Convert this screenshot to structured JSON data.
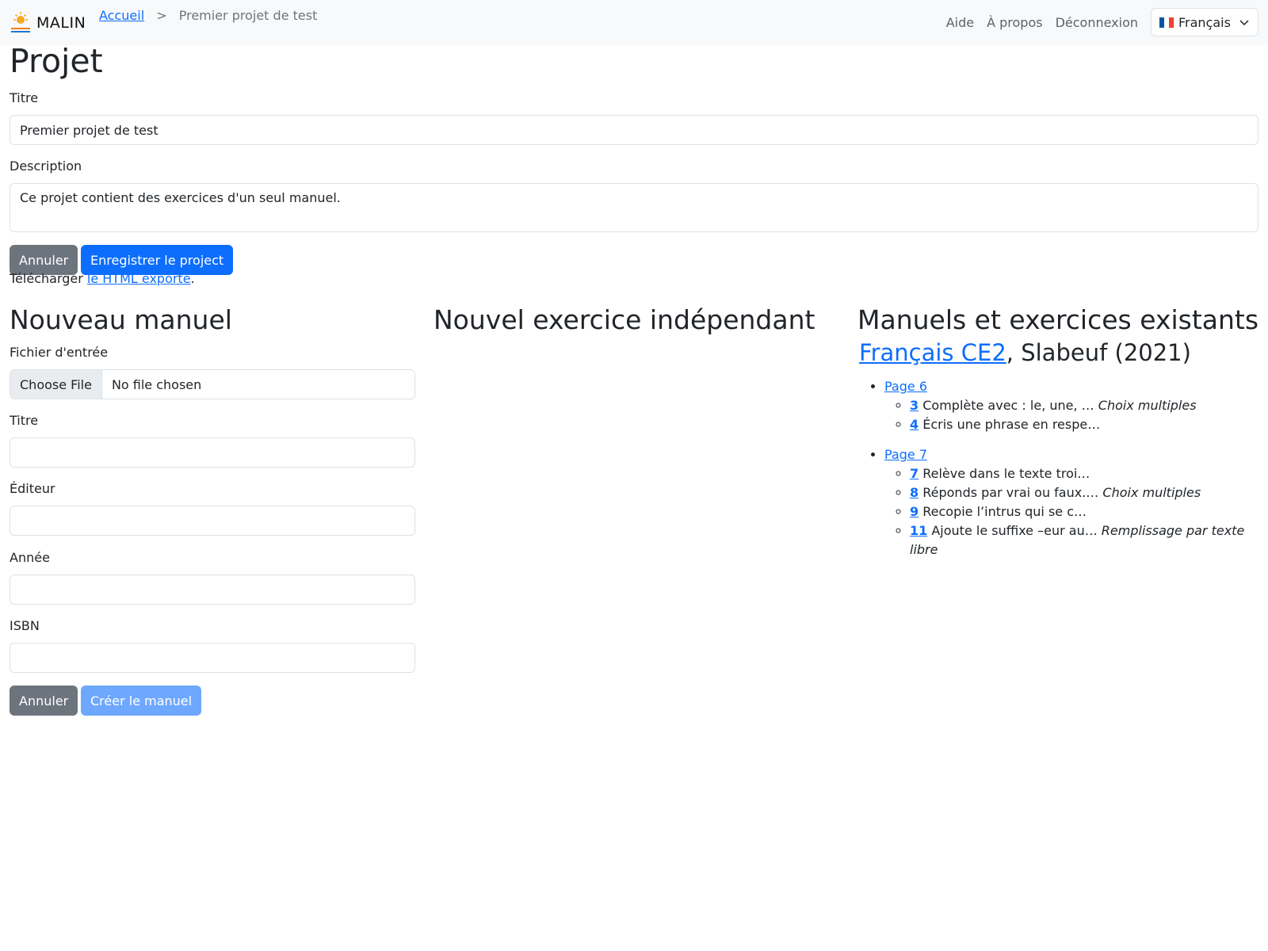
{
  "navbar": {
    "brand": "MALIN",
    "breadcrumb": {
      "home": "Accueil",
      "separator": ">",
      "current": "Premier projet de test"
    },
    "links": [
      "Aide",
      "À propos",
      "Déconnexion"
    ],
    "language": "Français"
  },
  "project": {
    "heading": "Projet",
    "title_label": "Titre",
    "title_value": "Premier projet de test",
    "description_label": "Description",
    "description_value": "Ce projet contient des exercices d'un seul manuel.",
    "cancel_label": "Annuler",
    "save_label": "Enregistrer le project",
    "download_prefix": "Télécharger ",
    "download_link": "le HTML exporté",
    "download_suffix": "."
  },
  "new_textbook": {
    "heading": "Nouveau manuel",
    "file_label": "Fichier d'entrée",
    "file_button": "Choose File",
    "file_status": "No file chosen",
    "title_label": "Titre",
    "editor_label": "Éditeur",
    "year_label": "Année",
    "isbn_label": "ISBN",
    "cancel_label": "Annuler",
    "create_label": "Créer le manuel"
  },
  "new_exercise": {
    "heading": "Nouvel exercice indépendant"
  },
  "existing": {
    "heading": "Manuels et exercices existants",
    "textbook": {
      "title": "Français CE2",
      "rest": ", Slabeuf (2021)"
    },
    "pages": [
      {
        "label": "Page 6",
        "exercises": [
          {
            "num": "3",
            "text": "Complète avec : le, une, …",
            "kind": "Choix multiples"
          },
          {
            "num": "4",
            "text": "Écris une phrase en respe…",
            "kind": ""
          }
        ]
      },
      {
        "label": "Page 7",
        "exercises": [
          {
            "num": "7",
            "text": "Relève dans le texte troi…",
            "kind": ""
          },
          {
            "num": "8",
            "text": "Réponds par vrai ou faux.…",
            "kind": "Choix multiples"
          },
          {
            "num": "9",
            "text": "Recopie l’intrus qui se c…",
            "kind": ""
          },
          {
            "num": "11",
            "text": "Ajoute le suffixe –eur au…",
            "kind": "Remplissage par texte libre"
          }
        ]
      }
    ]
  },
  "colors": {
    "navbar_bg": "#f8f9fa",
    "primary": "#0d6efd",
    "secondary": "#6c757d",
    "primary_disabled": "#6ea8fe"
  }
}
